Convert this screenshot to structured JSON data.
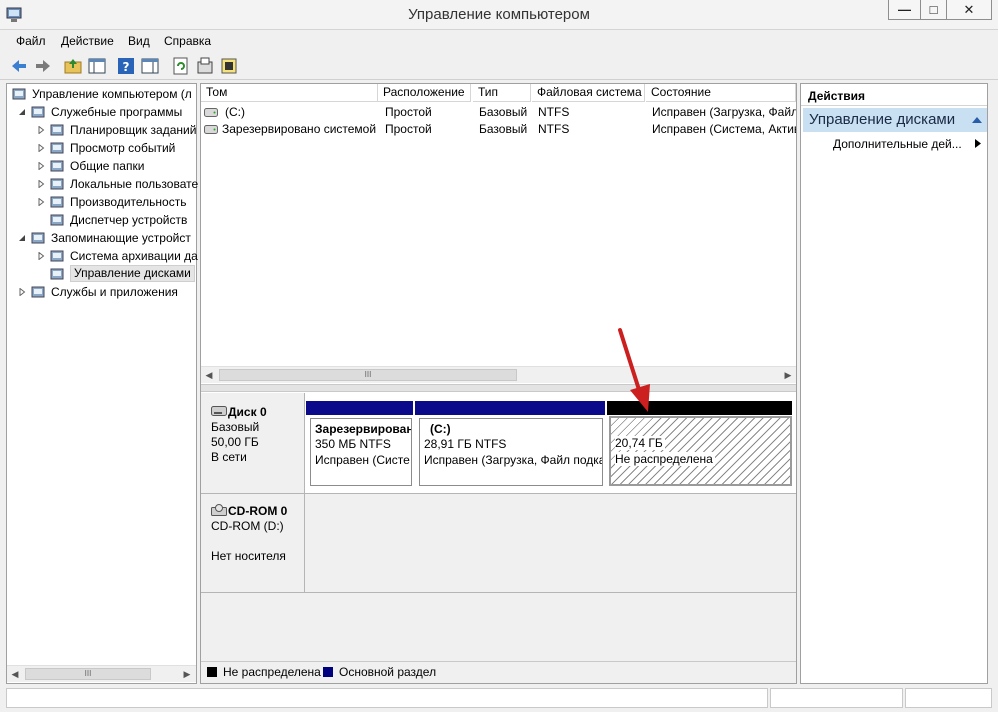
{
  "window": {
    "title": "Управление компьютером",
    "controls": {
      "minimize": "—",
      "maximize": "□",
      "close": "✕"
    }
  },
  "menu": [
    "Файл",
    "Действие",
    "Вид",
    "Справка"
  ],
  "tree": {
    "items": [
      {
        "label": "Управление компьютером (л",
        "level": 0,
        "expander": "none"
      },
      {
        "label": "Служебные программы",
        "level": 1,
        "expander": "expanded"
      },
      {
        "label": "Планировщик заданий",
        "level": 2,
        "expander": "collapsed"
      },
      {
        "label": "Просмотр событий",
        "level": 2,
        "expander": "collapsed"
      },
      {
        "label": "Общие папки",
        "level": 2,
        "expander": "collapsed"
      },
      {
        "label": "Локальные пользовате",
        "level": 2,
        "expander": "collapsed"
      },
      {
        "label": "Производительность",
        "level": 2,
        "expander": "collapsed"
      },
      {
        "label": "Диспетчер устройств",
        "level": 2,
        "expander": "none"
      },
      {
        "label": "Запоминающие устройст",
        "level": 1,
        "expander": "expanded"
      },
      {
        "label": "Система архивации да",
        "level": 2,
        "expander": "collapsed"
      },
      {
        "label": "Управление дисками",
        "level": 2,
        "expander": "none",
        "selected": true
      },
      {
        "label": "Службы и приложения",
        "level": 1,
        "expander": "collapsed"
      }
    ]
  },
  "volumes": {
    "columns": [
      "Том",
      "Расположение",
      "Тип",
      "Файловая система",
      "Состояние"
    ],
    "rows": [
      [
        "(C:)",
        "Простой",
        "Базовый",
        "NTFS",
        "Исправен (Загрузка, Файл"
      ],
      [
        "Зарезервировано системой",
        "Простой",
        "Базовый",
        "NTFS",
        "Исправен (Система, Актив"
      ]
    ],
    "scroll_thumb_label": "III"
  },
  "disks": {
    "disk0": {
      "name": "Диск 0",
      "type": "Базовый",
      "size": "50,00 ГБ",
      "status": "В сети",
      "partitions": [
        {
          "title": "Зарезервирован",
          "size": "350 МБ NTFS",
          "status": "Исправен (Систе"
        },
        {
          "title": "(C:)",
          "size": "28,91 ГБ NTFS",
          "status": "Исправен (Загрузка, Файл подка"
        },
        {
          "title": "",
          "size": "20,74 ГБ",
          "status": "Не распределена"
        }
      ]
    },
    "cdrom0": {
      "name": "CD-ROM 0",
      "type": "CD-ROM (D:)",
      "status": "Нет носителя"
    }
  },
  "legend": [
    {
      "label": "Не распределена",
      "color": "#000000"
    },
    {
      "label": "Основной раздел",
      "color": "#00007f"
    }
  ],
  "actions": {
    "header": "Действия",
    "section": "Управление дисками",
    "items": [
      "Дополнительные дей..."
    ]
  },
  "colors": {
    "primary_partition": "#0a0a8a",
    "unallocated": "#000000",
    "annotation_arrow": "#cc1f1f",
    "actions_section_bg": "#c9dff2"
  }
}
